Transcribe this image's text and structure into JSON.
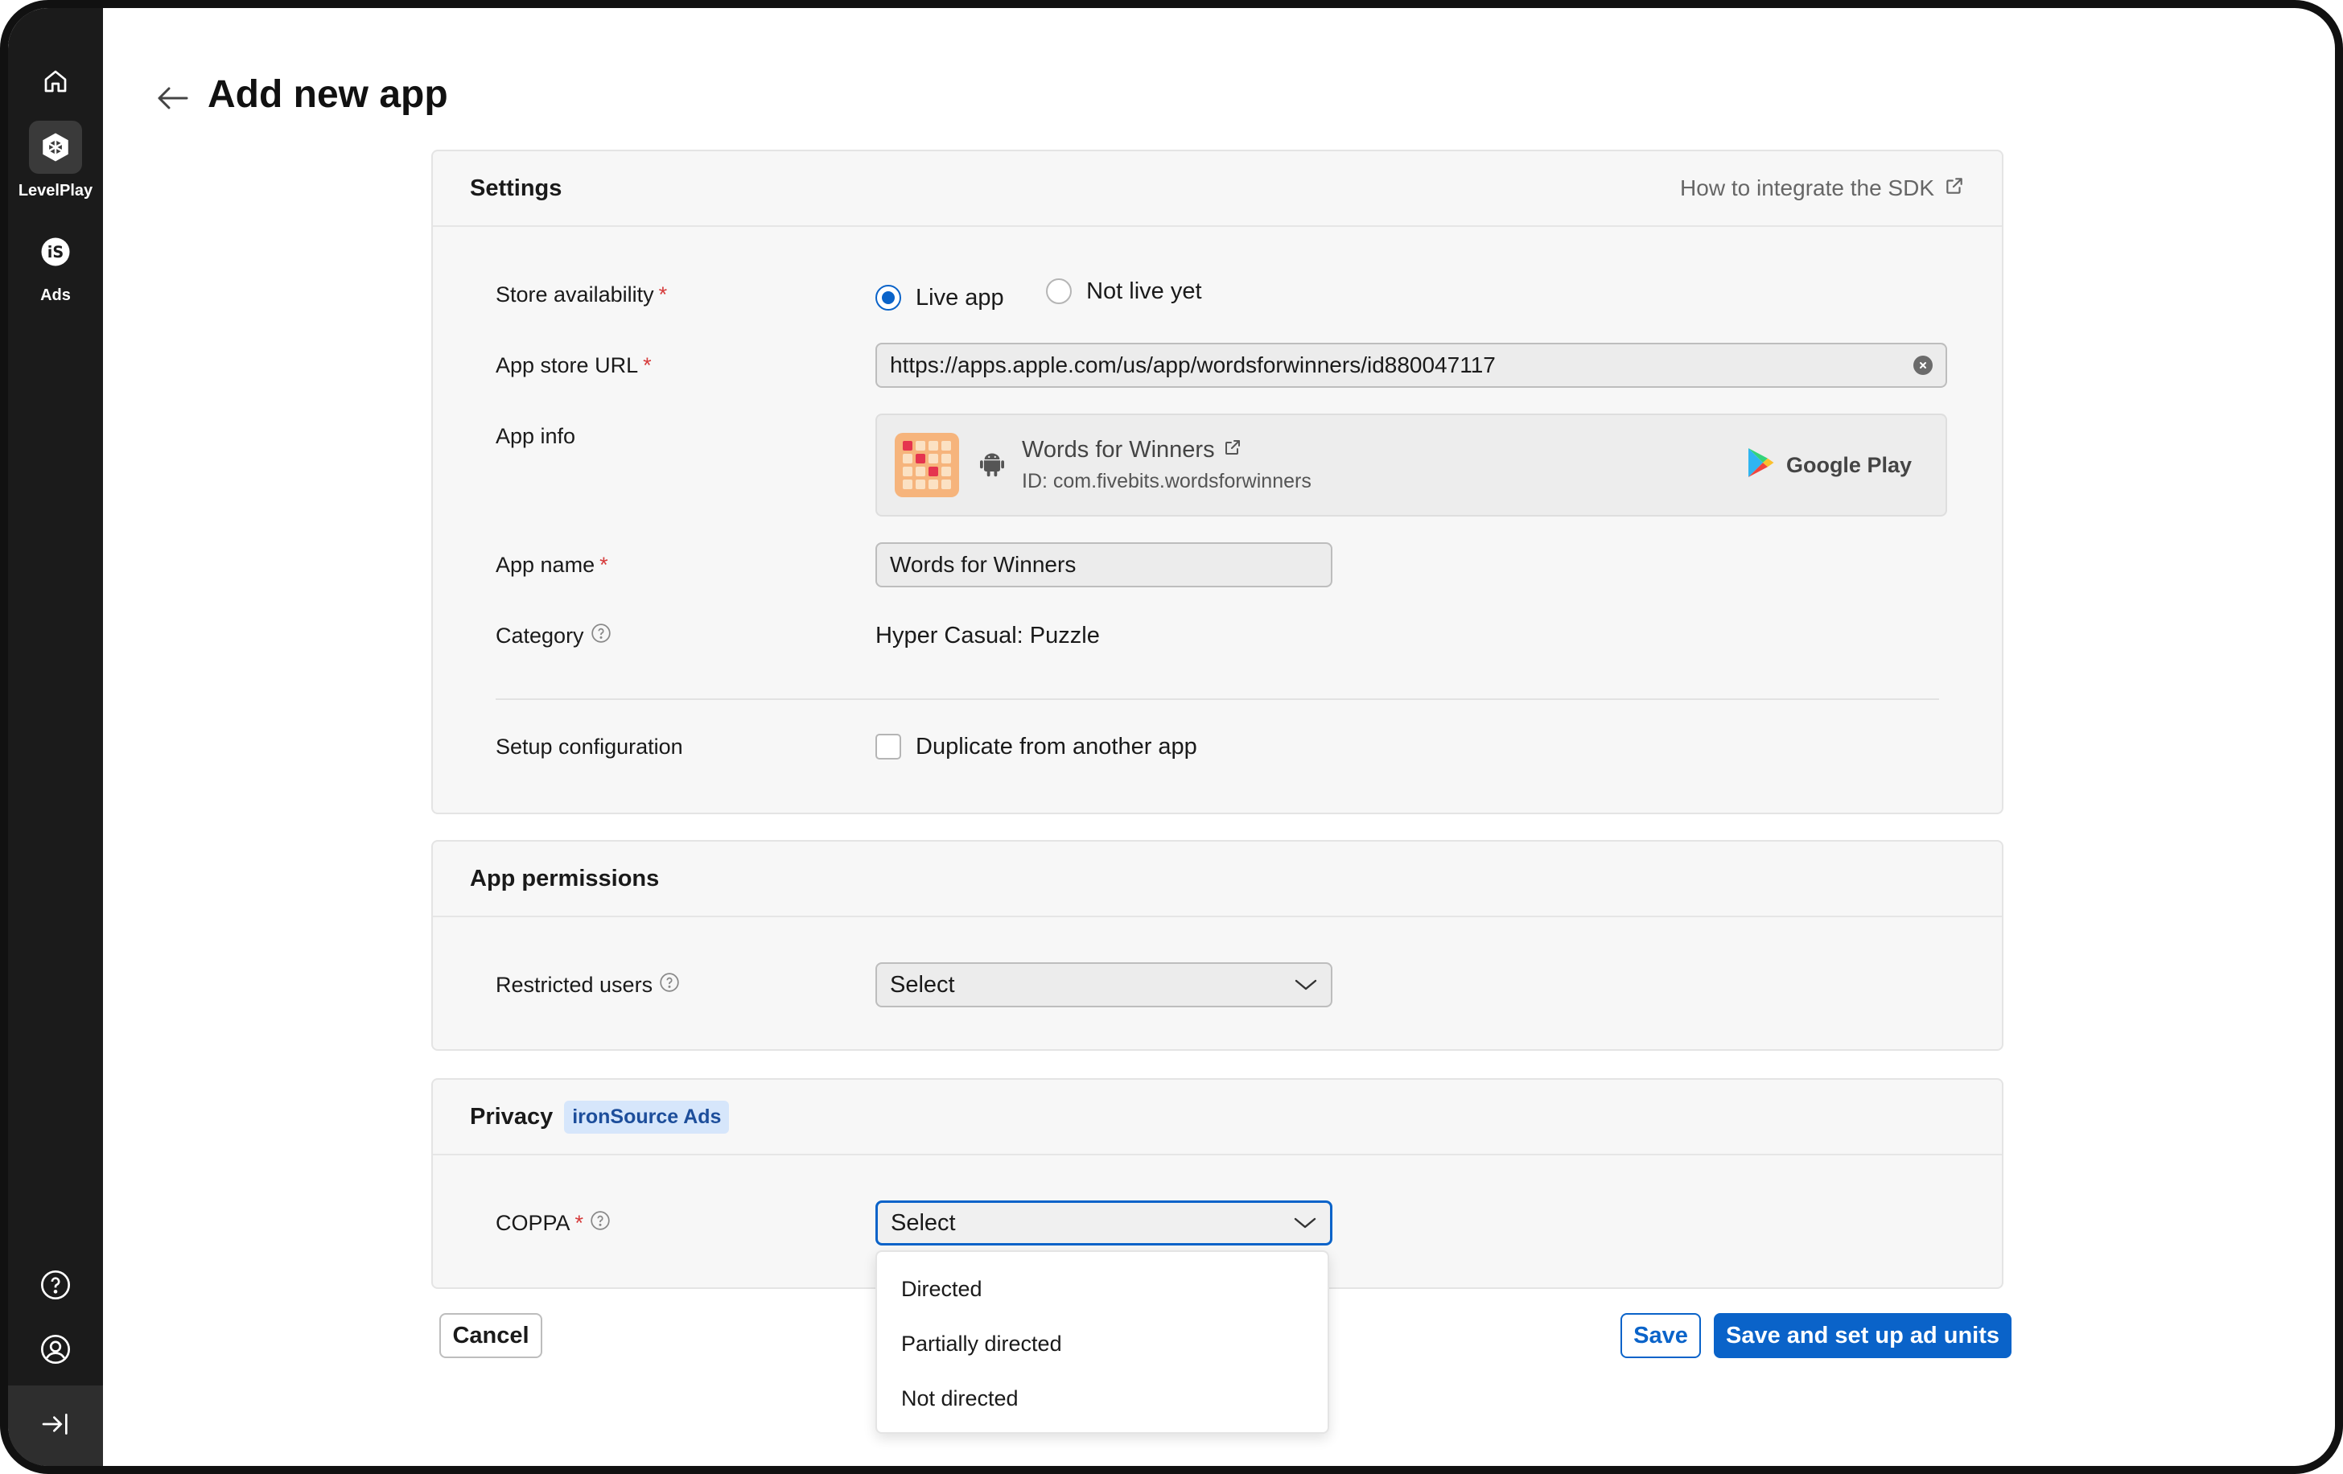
{
  "sidebar": {
    "items": [
      {
        "label": "",
        "icon": "home-icon"
      },
      {
        "label": "LevelPlay",
        "icon": "unity-icon"
      },
      {
        "label": "Ads",
        "icon": "ironsource-icon"
      }
    ],
    "bottom_icons": [
      "help-icon",
      "user-icon",
      "collapse-icon"
    ]
  },
  "header": {
    "title": "Add new app"
  },
  "settings": {
    "title": "Settings",
    "sdk_link": "How to integrate the SDK",
    "store_availability": {
      "label": "Store availability",
      "options": [
        "Live app",
        "Not live yet"
      ],
      "selected": "Live app"
    },
    "app_store_url": {
      "label": "App store URL",
      "value": "https://apps.apple.com/us/app/wordsforwinners/id880047117"
    },
    "app_info": {
      "label": "App info",
      "name": "Words for Winners",
      "id_text": "ID: com.fivebits.wordsforwinners",
      "store": "Google Play"
    },
    "app_name": {
      "label": "App name",
      "value": "Words for Winners"
    },
    "category": {
      "label": "Category",
      "value": "Hyper Casual: Puzzle"
    },
    "setup_configuration": {
      "label": "Setup configuration",
      "checkbox_label": "Duplicate from another app"
    }
  },
  "permissions": {
    "title": "App permissions",
    "restricted_users": {
      "label": "Restricted users",
      "value": "Select"
    }
  },
  "privacy": {
    "title": "Privacy",
    "badge": "ironSource Ads",
    "coppa": {
      "label": "COPPA",
      "value": "Select",
      "options": [
        "Directed",
        "Partially directed",
        "Not directed"
      ]
    }
  },
  "footer": {
    "cancel": "Cancel",
    "save": "Save",
    "save_and_setup": "Save and set up ad units"
  },
  "colors": {
    "accent": "#0a63c9",
    "required": "#d63b3b",
    "sidebar_bg": "#1b1b1b"
  }
}
